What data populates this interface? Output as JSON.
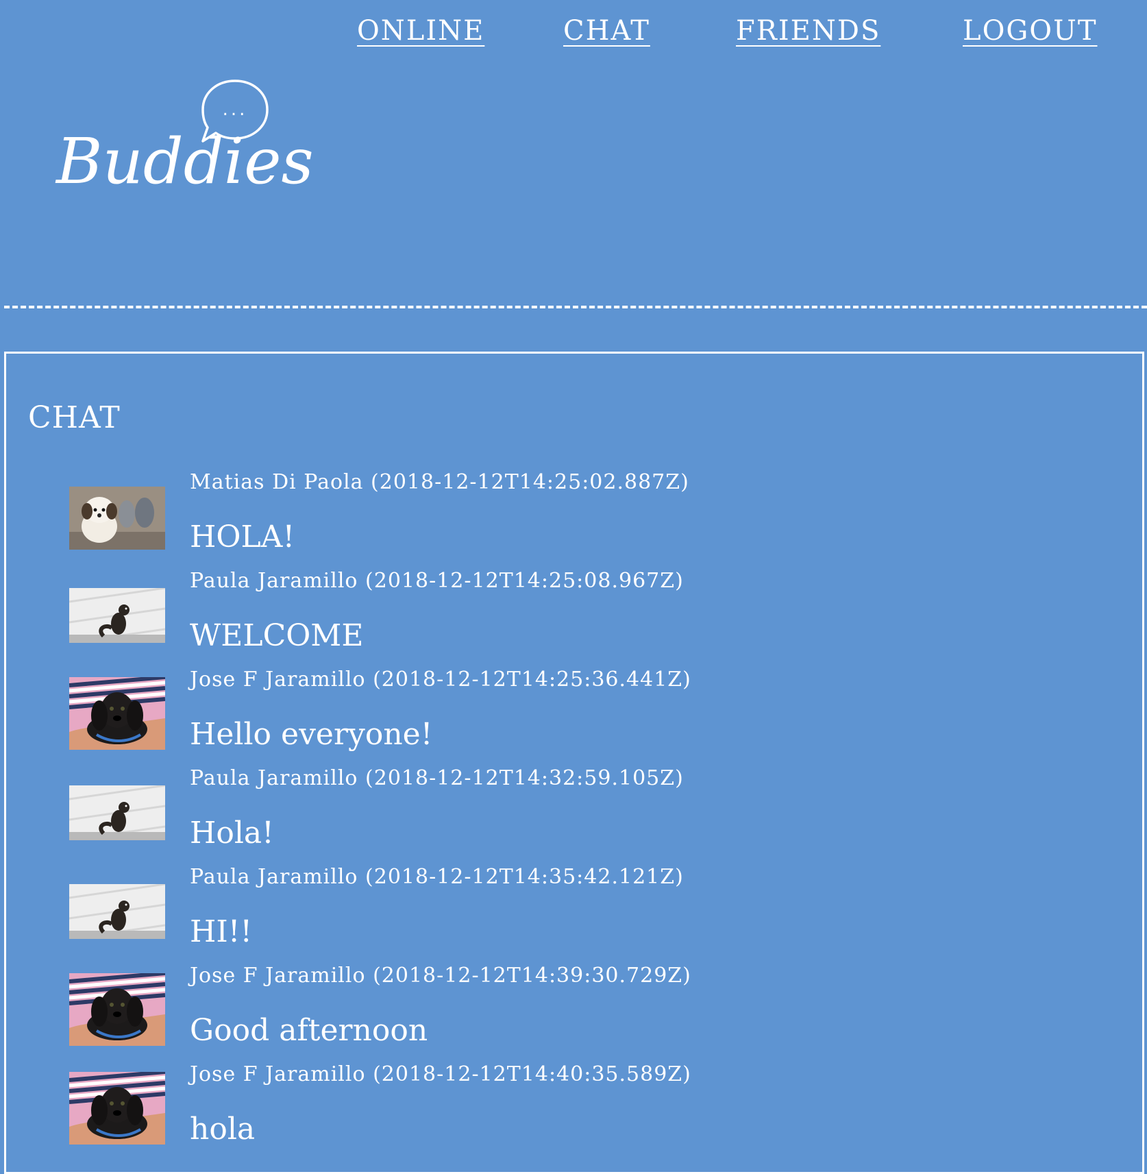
{
  "nav": {
    "online": "ONLINE",
    "chat": "CHAT",
    "friends": "FRIENDS",
    "logout": "LOGOUT"
  },
  "logo": {
    "name": "Buddies",
    "bubble": "..."
  },
  "chat": {
    "title": "CHAT",
    "messages": [
      {
        "meta": "Matias Di Paola (2018-12-12T14:25:02.887Z)",
        "text": "HOLA!",
        "avatar": "puppy-white-icon"
      },
      {
        "meta": "Paula Jaramillo (2018-12-12T14:25:08.967Z)",
        "text": "WELCOME",
        "avatar": "squirrel-icon"
      },
      {
        "meta": "Jose F Jaramillo (2018-12-12T14:25:36.441Z)",
        "text": "Hello everyone!",
        "avatar": "dachshund-icon"
      },
      {
        "meta": "Paula Jaramillo (2018-12-12T14:32:59.105Z)",
        "text": "Hola!",
        "avatar": "squirrel-icon"
      },
      {
        "meta": "Paula Jaramillo (2018-12-12T14:35:42.121Z)",
        "text": "HI!!",
        "avatar": "squirrel-icon"
      },
      {
        "meta": "Jose F Jaramillo (2018-12-12T14:39:30.729Z)",
        "text": "Good afternoon",
        "avatar": "dachshund-icon"
      },
      {
        "meta": "Jose F Jaramillo (2018-12-12T14:40:35.589Z)",
        "text": "hola",
        "avatar": "dachshund-icon"
      }
    ]
  }
}
